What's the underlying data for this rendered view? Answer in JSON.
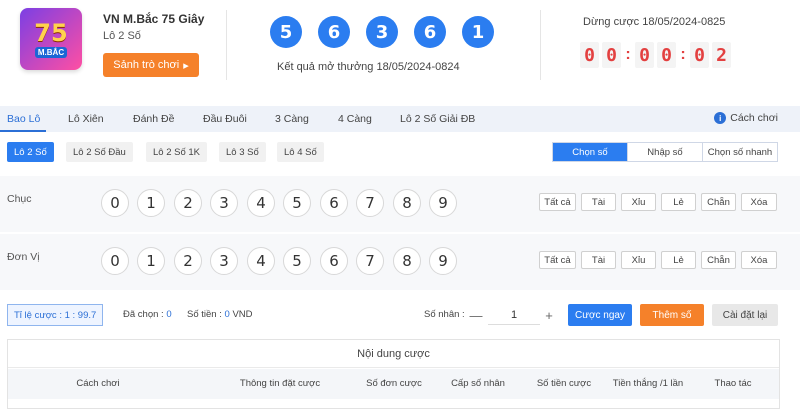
{
  "game": {
    "logo_number": "75",
    "logo_sub": "M.BẮC",
    "title": "VN M.Bắc 75 Giây",
    "subtitle": "Lô 2 Số",
    "lobby_button": "Sảnh trò chơi",
    "lobby_arrow": "▸"
  },
  "result": {
    "balls": [
      "5",
      "6",
      "3",
      "6",
      "1"
    ],
    "text": "Kết quả mở thưởng 18/05/2024-0824"
  },
  "countdown": {
    "label": "Dừng cược 18/05/2024-0825",
    "digits": [
      "0",
      "0",
      "0",
      "0",
      "0",
      "2"
    ],
    "separator": ":"
  },
  "tabs": [
    {
      "label": "Bao Lô",
      "active": true
    },
    {
      "label": "Lô Xiên"
    },
    {
      "label": "Đánh Đề"
    },
    {
      "label": "Đầu Đuôi"
    },
    {
      "label": "3 Càng"
    },
    {
      "label": "4 Càng"
    },
    {
      "label": "Lô 2 Số Giải ĐB"
    }
  ],
  "howto": {
    "icon": "i",
    "label": "Cách chơi"
  },
  "subtabs": [
    {
      "label": "Lô 2 Số",
      "active": true
    },
    {
      "label": "Lô 2 Số Đầu"
    },
    {
      "label": "Lô 2 Số 1K"
    },
    {
      "label": "Lô 3 Số"
    },
    {
      "label": "Lô 4 Số"
    }
  ],
  "modes": [
    {
      "label": "Chọn số",
      "active": true
    },
    {
      "label": "Nhập số"
    },
    {
      "label": "Chọn số nhanh"
    }
  ],
  "rows": [
    {
      "label": "Chục",
      "numbers": [
        "0",
        "1",
        "2",
        "3",
        "4",
        "5",
        "6",
        "7",
        "8",
        "9"
      ]
    },
    {
      "label": "Đơn Vị",
      "numbers": [
        "0",
        "1",
        "2",
        "3",
        "4",
        "5",
        "6",
        "7",
        "8",
        "9"
      ]
    }
  ],
  "quick": [
    "Tất cả",
    "Tài",
    "Xỉu",
    "Lẻ",
    "Chẵn",
    "Xóa"
  ],
  "bet": {
    "rate_label": "Tỉ lệ cược :",
    "rate_value": "1 : 99.7",
    "chosen_label": "Đã chọn :",
    "chosen_value": "0",
    "amount_label": "Số tiền :",
    "amount_value": "0",
    "amount_unit": "VND",
    "multiplier_label": "Số nhân :",
    "minus": "—",
    "multiplier_value": "1",
    "plus": "+",
    "bet_now": "Cược ngay",
    "add_number": "Thêm số",
    "reset": "Cài đặt lại"
  },
  "table": {
    "title": "Nội dung cược",
    "columns": [
      "Cách chơi",
      "Thông tin đặt cược",
      "Số đơn cược",
      "Cấp số nhân",
      "Số tiền cược",
      "Tiền thắng /1 lần",
      "Thao tác"
    ]
  },
  "colors": {
    "accent": "#2b7df0",
    "orange": "#f5812a",
    "countdown_red": "#e34040"
  }
}
